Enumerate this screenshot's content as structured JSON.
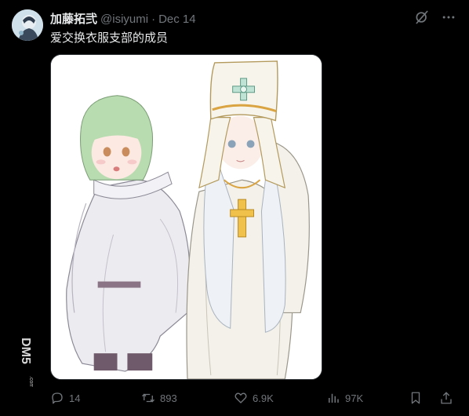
{
  "author": {
    "display_name": "加藤拓弐",
    "handle": "@isiyumi",
    "separator": "·",
    "date": "Dec 14"
  },
  "tweet": {
    "text": "爱交换衣服支部的成员"
  },
  "stats": {
    "replies": "14",
    "reposts": "893",
    "likes": "6.9K",
    "views": "97K"
  },
  "watermark": {
    "text": "DM5.com"
  },
  "colors": {
    "background": "#000000",
    "text_primary": "#e7e9ea",
    "text_secondary": "#71767b"
  },
  "icons": {
    "grok": "grok-icon",
    "more": "more-horizontal-icon",
    "reply": "reply-icon",
    "repost": "repost-icon",
    "like": "heart-icon",
    "views": "views-icon",
    "bookmark": "bookmark-icon",
    "share": "share-icon"
  }
}
